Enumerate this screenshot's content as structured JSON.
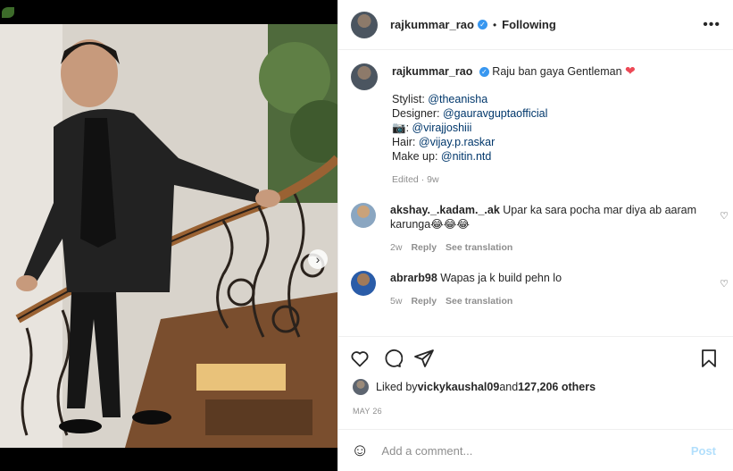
{
  "post_header": {
    "username": "rajkummar_rao",
    "verified_glyph": "✓",
    "separator": "•",
    "follow_status": "Following",
    "more_label": "•••"
  },
  "caption": {
    "username": "rajkummar_rao",
    "verified_glyph": "✓",
    "text": "Raju ban gaya Gentleman",
    "heart": "❤",
    "credits": [
      {
        "label": "Stylist: ",
        "tag": "@theanisha"
      },
      {
        "label": "Designer: ",
        "tag": "@gauravguptaofficial"
      },
      {
        "label": "📷: ",
        "tag": "@virajjoshiii"
      },
      {
        "label": "Hair: ",
        "tag": "@vijay.p.raskar"
      },
      {
        "label": "Make up: ",
        "tag": "@nitin.ntd"
      }
    ],
    "meta": "Edited · 9w"
  },
  "comments": [
    {
      "username": "akshay._.kadam._.ak",
      "text": "Upar ka sara pocha mar diya ab aaram karunga😂😂😂",
      "age": "2w",
      "reply": "Reply",
      "translate": "See translation"
    },
    {
      "username": "abrarb98",
      "text": "Wapas ja k build pehn lo",
      "age": "5w",
      "reply": "Reply",
      "translate": "See translation"
    }
  ],
  "likes": {
    "prefix": "Liked by ",
    "user": "vickykaushal09",
    "middle": " and ",
    "count": "127,206 others"
  },
  "date": "MAY 26",
  "add_comment": {
    "placeholder": "Add a comment...",
    "emoji": "☺",
    "post_label": "Post"
  },
  "carousel": {
    "next_glyph": "›",
    "current_index": 0,
    "total": 2
  },
  "colors": {
    "accent": "#3897f0",
    "heart": "#ed4956",
    "tag": "#00376b",
    "muted": "#8e8e8e",
    "post_disabled": "#b2dffc"
  }
}
